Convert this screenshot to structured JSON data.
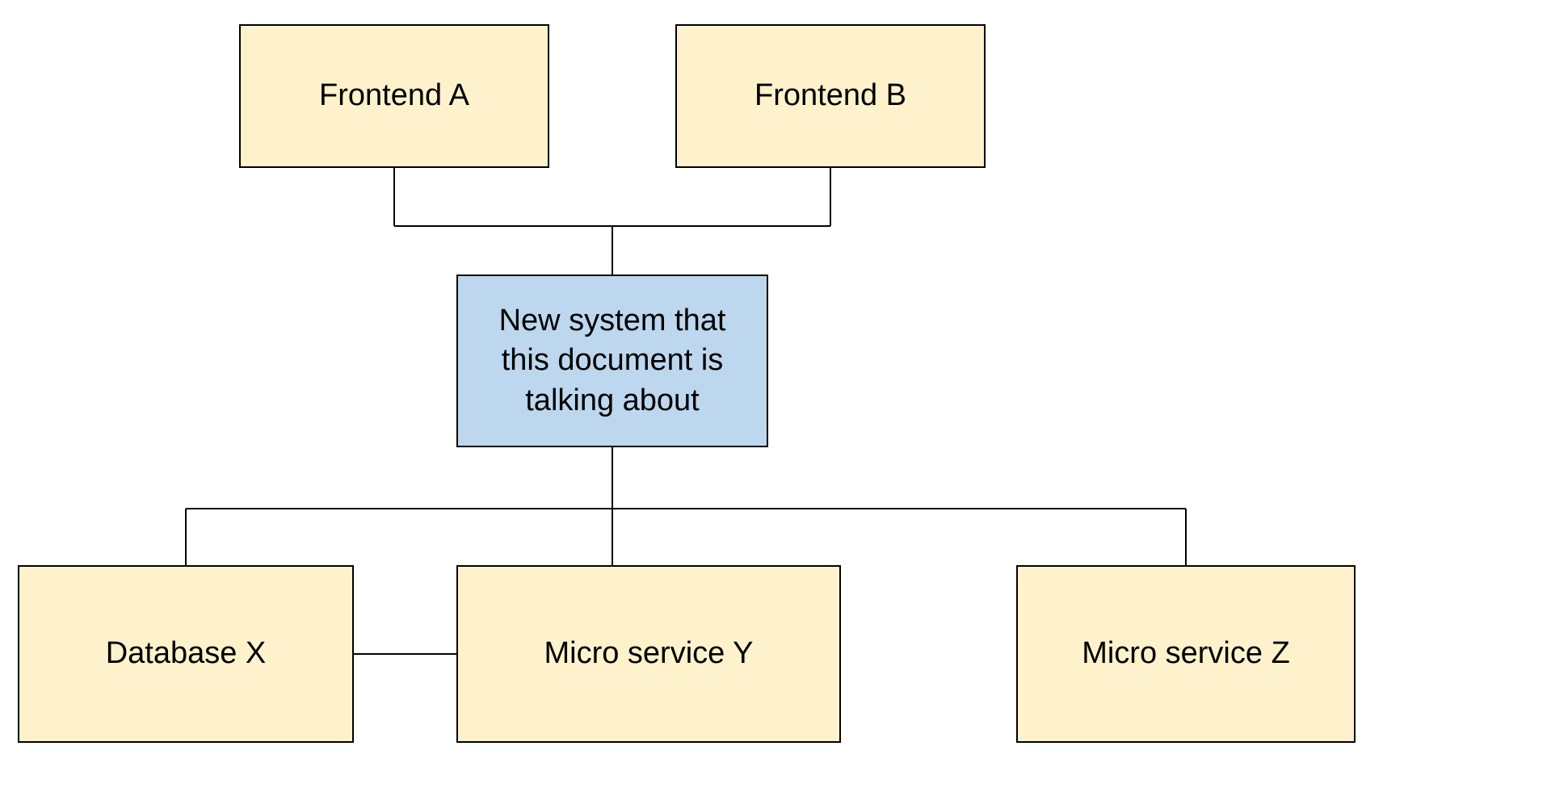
{
  "nodes": {
    "frontend_a": {
      "label": "Frontend A"
    },
    "frontend_b": {
      "label": "Frontend B"
    },
    "new_system": {
      "label": "New system that this document is talking about"
    },
    "database_x": {
      "label": "Database X"
    },
    "microservice_y": {
      "label": "Micro service Y"
    },
    "microservice_z": {
      "label": "Micro service Z"
    }
  },
  "colors": {
    "yellow_fill": "#fdf2cc",
    "blue_fill": "#bdd7ee",
    "border": "#000000"
  }
}
